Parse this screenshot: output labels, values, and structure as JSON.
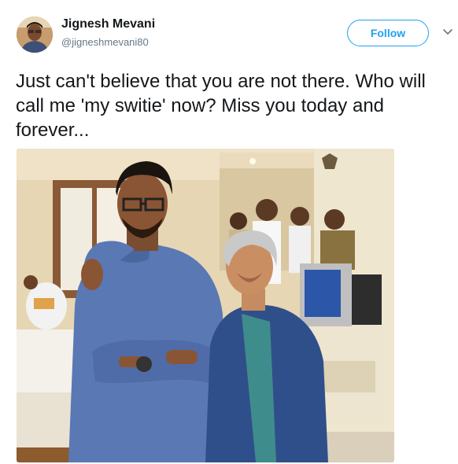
{
  "tweet": {
    "author_name": "Jignesh Mevani",
    "author_handle": "@jigneshmevani80",
    "follow_label": "Follow",
    "text": "Just can't believe that you are not there. Who will call me 'my switie' now? Miss you today and forever...",
    "photo_description": "photo-of-two-people"
  },
  "colors": {
    "accent": "#1da1f2",
    "text": "#14171a",
    "secondary_text": "#657786"
  },
  "icons": {
    "more_menu": "chevron-down-icon"
  }
}
